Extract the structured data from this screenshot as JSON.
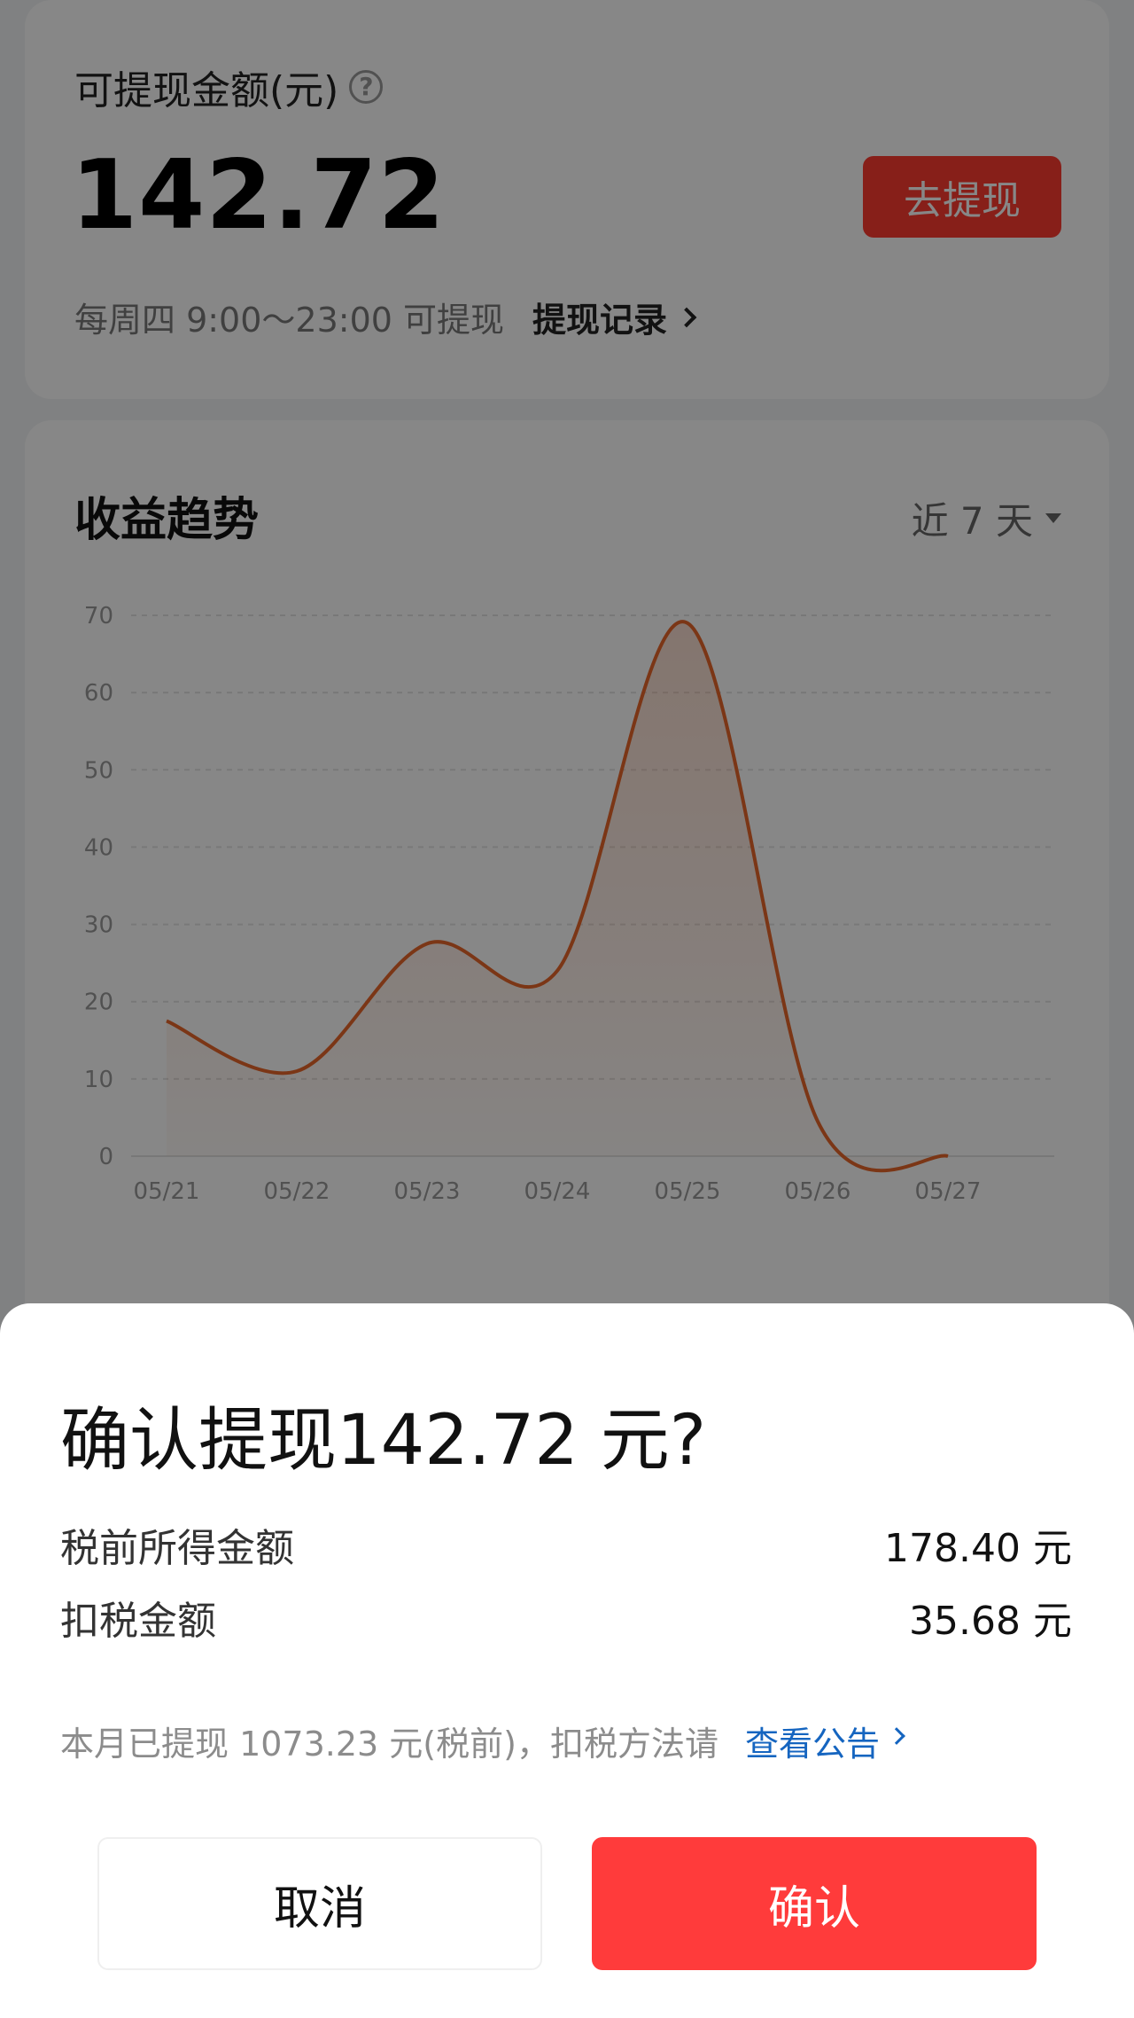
{
  "balance": {
    "label": "可提现金额(元)",
    "help_icon": "?",
    "amount": "142.72",
    "withdraw_button": "去提现",
    "hint": "每周四 9:00～23:00 可提现",
    "record_link": "提现记录"
  },
  "trend": {
    "title": "收益趋势",
    "range": "近 7 天"
  },
  "chart_data": {
    "type": "area",
    "categories": [
      "05/21",
      "05/22",
      "05/23",
      "05/24",
      "05/25",
      "05/26",
      "05/27"
    ],
    "values": [
      17.5,
      11,
      27.5,
      24,
      69,
      4.5,
      0
    ],
    "ylim": [
      0,
      70
    ],
    "yticks": [
      0,
      10,
      20,
      30,
      40,
      50,
      60,
      70
    ],
    "grid": true,
    "line_color": "#e8672a"
  },
  "dialog": {
    "title": "确认提现142.72 元?",
    "rows": [
      {
        "label": "税前所得金额",
        "value": "178.40 元"
      },
      {
        "label": "扣税金额",
        "value": "35.68 元"
      }
    ],
    "note": "本月已提现 1073.23 元(税前)，扣税方法请",
    "note_link": "查看公告",
    "cancel": "取消",
    "confirm": "确认"
  }
}
